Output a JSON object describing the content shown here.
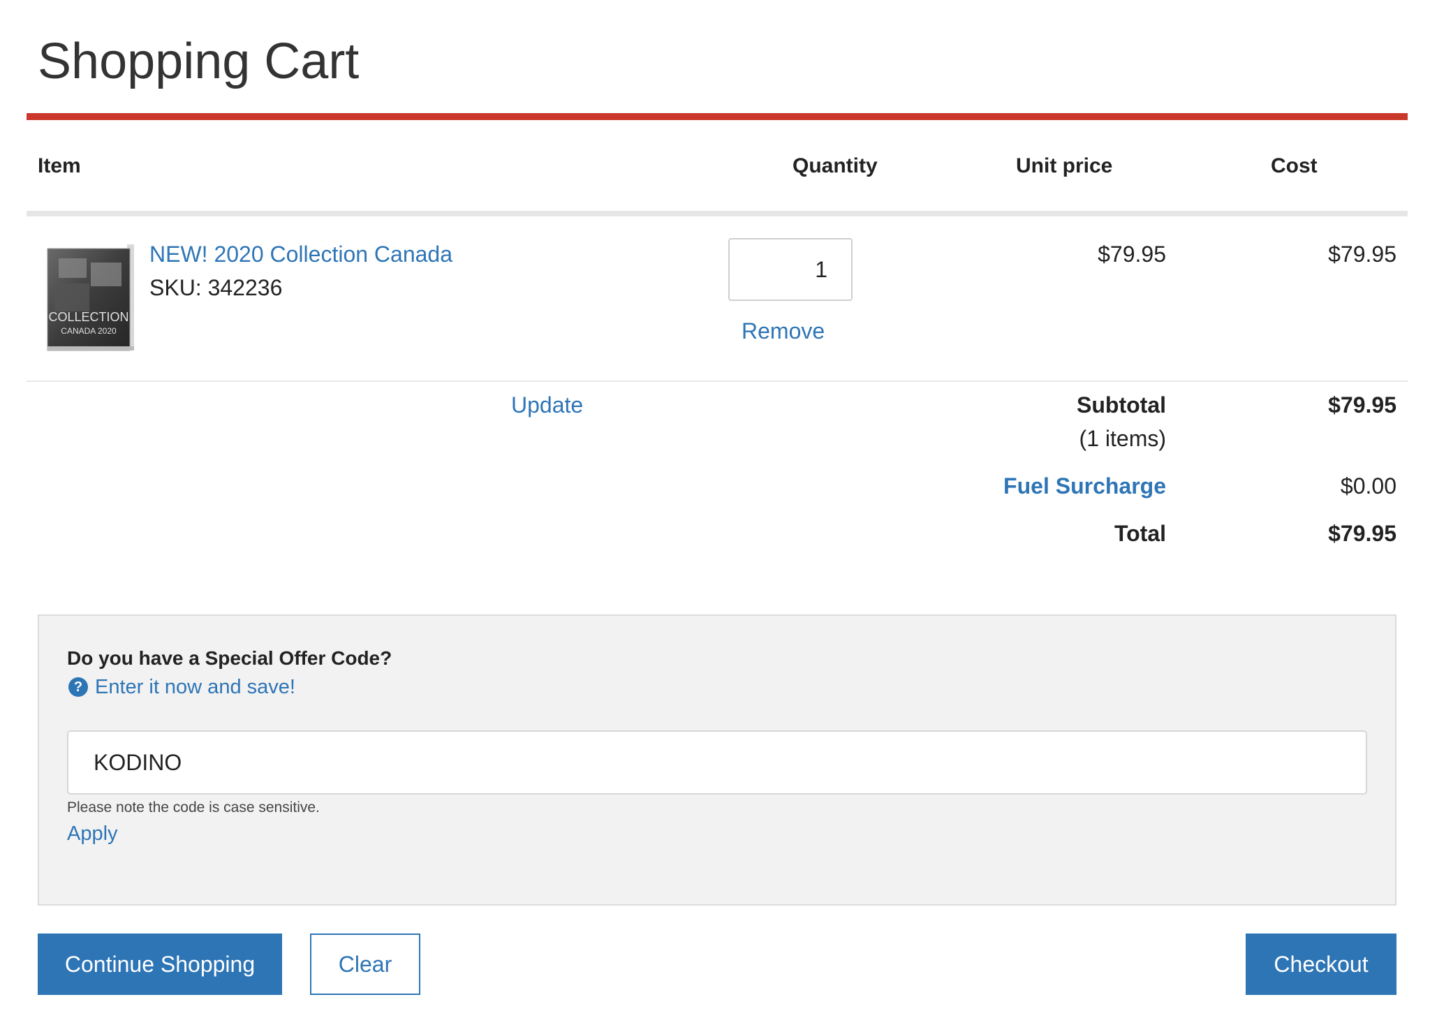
{
  "page": {
    "title": "Shopping Cart"
  },
  "table": {
    "headers": {
      "item": "Item",
      "quantity": "Quantity",
      "unit_price": "Unit price",
      "cost": "Cost"
    }
  },
  "cart_item": {
    "name": "NEW! 2020 Collection Canada",
    "sku": "SKU: 342236",
    "thumbnail_text_1": "COLLECTION",
    "thumbnail_text_2": "CANADA 2020",
    "quantity": "1",
    "remove_label": "Remove",
    "unit_price": "$79.95",
    "cost": "$79.95"
  },
  "summary": {
    "update_label": "Update",
    "subtotal_label": "Subtotal",
    "subtotal_count": "(1 items)",
    "subtotal_value": "$79.95",
    "fuel_label": "Fuel Surcharge",
    "fuel_value": "$0.00",
    "total_label": "Total",
    "total_value": "$79.95"
  },
  "offer": {
    "question": "Do you have a Special Offer Code?",
    "help_icon": "question-circle-icon",
    "help_glyph": "?",
    "enter_link": "Enter it now and save!",
    "code_value": "KODINO",
    "note": "Please note the code is case sensitive.",
    "apply_label": "Apply"
  },
  "actions": {
    "continue_label": "Continue Shopping",
    "clear_label": "Clear",
    "checkout_label": "Checkout"
  },
  "colors": {
    "accent_red": "#c9382a",
    "link_blue": "#2e75b6",
    "panel_gray": "#f2f2f2"
  }
}
